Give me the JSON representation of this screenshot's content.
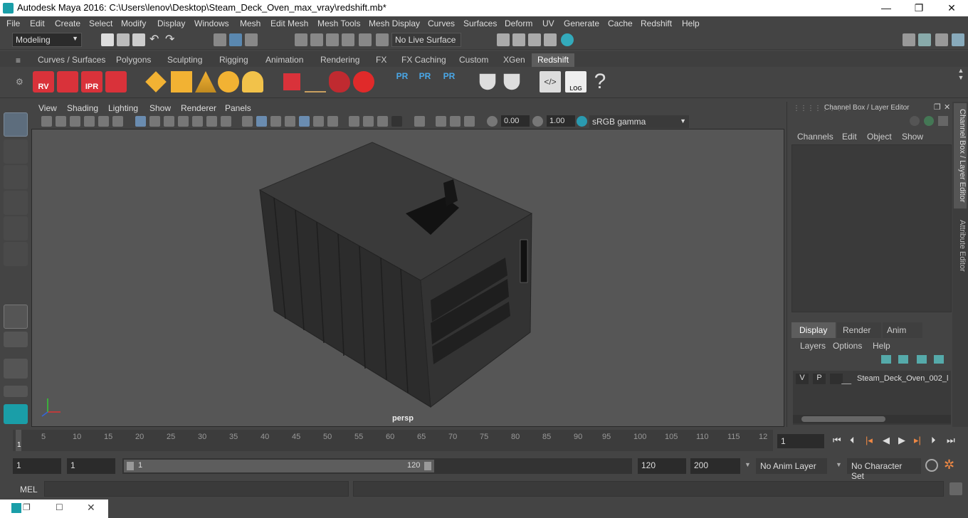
{
  "window": {
    "title": "Autodesk Maya 2016: C:\\Users\\lenov\\Desktop\\Steam_Deck_Oven_max_vray\\redshift.mb*"
  },
  "menubar": [
    "File",
    "Edit",
    "Create",
    "Select",
    "Modify",
    "Display",
    "Windows",
    "Mesh",
    "Edit Mesh",
    "Mesh Tools",
    "Mesh Display",
    "Curves",
    "Surfaces",
    "Deform",
    "UV",
    "Generate",
    "Cache",
    "Redshift",
    "Help"
  ],
  "statusline": {
    "mode": "Modeling",
    "live_surface": "No Live Surface"
  },
  "shelf_tabs": [
    "Curves / Surfaces",
    "Polygons",
    "Sculpting",
    "Rigging",
    "Animation",
    "Rendering",
    "FX",
    "FX Caching",
    "Custom",
    "XGen",
    "Redshift"
  ],
  "shelf_active": "Redshift",
  "shelf_icons": {
    "rv": "RV",
    "ipr": "IPR",
    "pr": "PR",
    "log": "LOG",
    "help": "?"
  },
  "viewport": {
    "menus": [
      "View",
      "Shading",
      "Lighting",
      "Show",
      "Renderer",
      "Panels"
    ],
    "exposure": "0.00",
    "gamma": "1.00",
    "colorspace": "sRGB gamma",
    "camera": "persp"
  },
  "channelbox": {
    "title": "Channel Box / Layer Editor",
    "menus": [
      "Channels",
      "Edit",
      "Object",
      "Show"
    ],
    "layer_tabs": [
      "Display",
      "Render",
      "Anim"
    ],
    "layer_menus": [
      "Layers",
      "Options",
      "Help"
    ],
    "layer": {
      "v": "V",
      "p": "P",
      "name": "Steam_Deck_Oven_002_l"
    }
  },
  "side_tabs": [
    "Channel Box / Layer Editor",
    "Attribute Editor"
  ],
  "timeline": {
    "ticks": [
      "5",
      "10",
      "15",
      "20",
      "25",
      "30",
      "35",
      "40",
      "45",
      "50",
      "55",
      "60",
      "65",
      "70",
      "75",
      "80",
      "85",
      "90",
      "95",
      "100",
      "105",
      "110",
      "115",
      "12"
    ],
    "current_frame_marker": "1",
    "current_frame": "1"
  },
  "range": {
    "start": "1",
    "playback_start": "1",
    "slider_start": "1",
    "slider_end": "120",
    "playback_end": "120",
    "end": "200",
    "anim_layer": "No Anim Layer",
    "character_set": "No Character Set"
  },
  "cmdline": {
    "label": "MEL"
  },
  "colors": {
    "bg": "#444444",
    "viewport": "#565656",
    "accent": "#5d5d5d",
    "redshift": "#d9323a"
  }
}
